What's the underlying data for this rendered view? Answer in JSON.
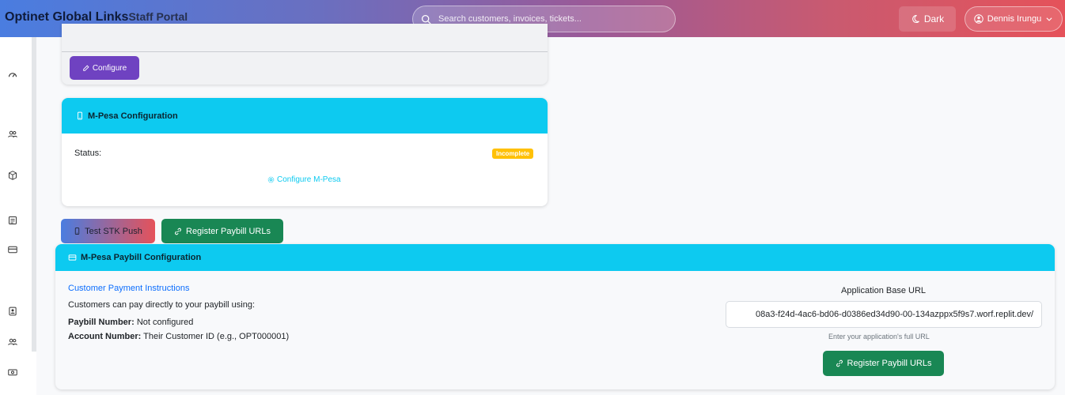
{
  "header": {
    "brand_name": "Optinet Global Links",
    "brand_subtitle": "Staff Portal",
    "search_placeholder": "Search customers, invoices, tickets...",
    "dark_label": "Dark",
    "user_name": "Dennis Irungu"
  },
  "sidebar": {
    "icons": [
      "dashboard-icon",
      "users-icon",
      "box-icon",
      "invoice-icon",
      "card-icon",
      "contact-icon",
      "team-icon",
      "money-icon"
    ]
  },
  "top_card": {
    "configure_label": "Configure"
  },
  "mpesa_card": {
    "title": "M-Pesa Configuration",
    "status_label": "Status:",
    "status_badge": "Incomplete",
    "configure_link": "Configure M-Pesa"
  },
  "actions": {
    "test_stk_label": "Test STK Push",
    "register_paybill_label": "Register Paybill URLs"
  },
  "paybill_card": {
    "title": "M-Pesa Paybill Configuration",
    "instructions_title": "Customer Payment Instructions",
    "instructions_text": "Customers can pay directly to your paybill using:",
    "paybill_number_label": "Paybill Number:",
    "paybill_number_value": "Not configured",
    "account_number_label": "Account Number:",
    "account_number_value": "Their Customer ID (e.g., OPT000001)",
    "base_url_label": "Application Base URL",
    "base_url_value": "08a3-f24d-4ac6-bd06-d0386ed34d90-00-134azppx5f9s7.worf.replit.dev/",
    "base_url_help": "Enter your application's full URL",
    "register_label": "Register Paybill URLs"
  },
  "colors": {
    "info": "#0dcaf0",
    "success": "#198754",
    "purple": "#6f42c1",
    "warning": "#ffc107",
    "link": "#0d6efd"
  }
}
